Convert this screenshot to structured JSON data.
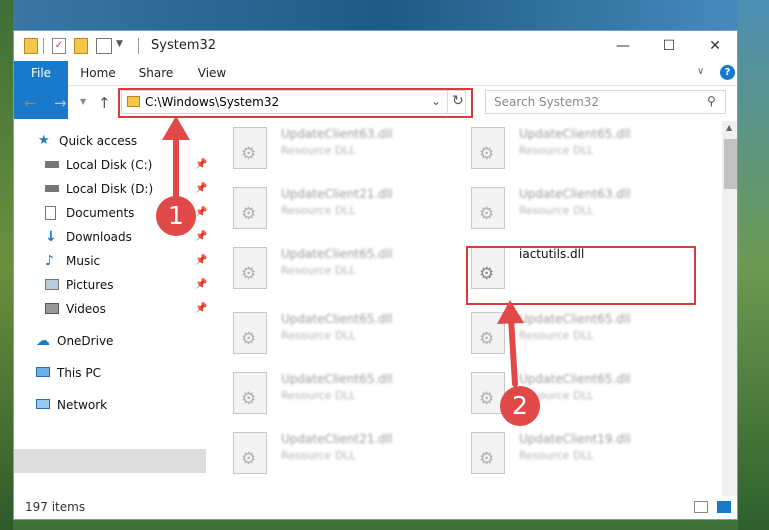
{
  "window": {
    "title": "System32",
    "controls": [
      "—",
      "☐",
      "✕"
    ]
  },
  "ribbon": {
    "tabs": [
      "File",
      "Home",
      "Share",
      "View"
    ]
  },
  "address": {
    "path": "C:\\Windows\\System32",
    "search_placeholder": "Search System32"
  },
  "sidebar": {
    "items": [
      {
        "label": "Quick access",
        "icon": "star-icon",
        "pinned": false
      },
      {
        "label": "Local Disk (C:)",
        "icon": "drive-icon",
        "pinned": true
      },
      {
        "label": "Local Disk (D:)",
        "icon": "drive-icon",
        "pinned": true
      },
      {
        "label": "Documents",
        "icon": "document-icon",
        "pinned": true
      },
      {
        "label": "Downloads",
        "icon": "download-arrow-icon",
        "pinned": true
      },
      {
        "label": "Music",
        "icon": "music-note-icon",
        "pinned": true
      },
      {
        "label": "Pictures",
        "icon": "picture-icon",
        "pinned": true
      },
      {
        "label": "Videos",
        "icon": "video-icon",
        "pinned": true
      },
      {
        "label": "OneDrive",
        "icon": "cloud-icon",
        "pinned": false
      },
      {
        "label": "This PC",
        "icon": "computer-icon",
        "pinned": false
      },
      {
        "label": "Network",
        "icon": "network-icon",
        "pinned": false
      }
    ]
  },
  "files": [
    {
      "name": "UpdateClient63.dll",
      "type": "Resource DLL"
    },
    {
      "name": "UpdateClient65.dll",
      "type": "Resource DLL"
    },
    {
      "name": "UpdateClient21.dll",
      "type": "Resource DLL"
    },
    {
      "name": "UpdateClient63.dll",
      "type": "Resource DLL"
    },
    {
      "name": "UpdateClient65.dll",
      "type": "Resource DLL"
    },
    {
      "name": "iactutils.dll",
      "type": ""
    },
    {
      "name": "UpdateClient65.dll",
      "type": "Resource DLL"
    },
    {
      "name": "UpdateClient65.dll",
      "type": "Resource DLL"
    },
    {
      "name": "UpdateClient65.dll",
      "type": "Resource DLL"
    },
    {
      "name": "UpdateClient65.dll",
      "type": "Resource DLL"
    },
    {
      "name": "UpdateClient21.dll",
      "type": "Resource DLL"
    },
    {
      "name": "UpdateClient19.dll",
      "type": "Resource DLL"
    }
  ],
  "status": {
    "item_count": "197 items"
  },
  "annotations": {
    "step1": "1",
    "step2": "2"
  },
  "colors": {
    "accent": "#1979ca",
    "annotation_red": "#d83b3b"
  }
}
